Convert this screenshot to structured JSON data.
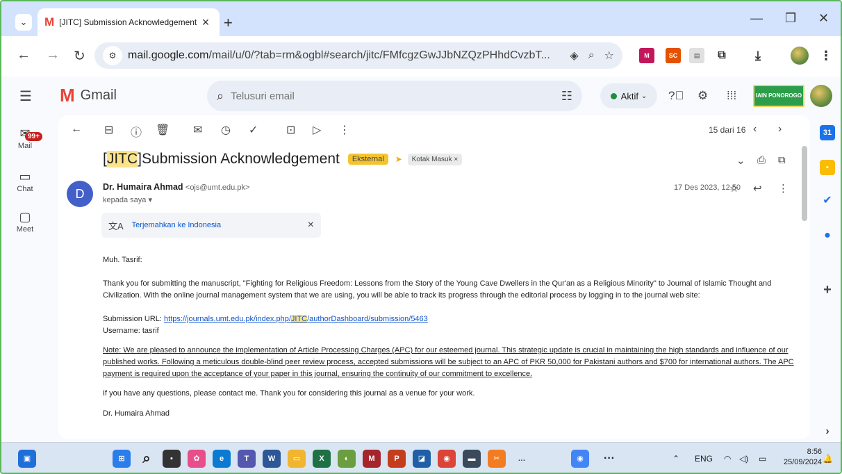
{
  "browser": {
    "tab_title": "[JITC] Submission Acknowledgement",
    "tab_favicon": "M",
    "url_host": "mail.google.com",
    "url_rest": "/mail/u/0/?tab=rm&ogbl#search/jitc/FMfcgzGwJJbNZQzPHhdCvzbT..."
  },
  "gmail": {
    "logo_text": "Gmail",
    "search_placeholder": "Telusuri email",
    "status": "Aktif",
    "org_logo": "IAIN PONOROGO",
    "rail": [
      {
        "label": "Mail",
        "badge": "99+"
      },
      {
        "label": "Chat"
      },
      {
        "label": "Meet"
      }
    ]
  },
  "email": {
    "pager": "15 dari 16",
    "subject_tag": "JITC",
    "subject_rest": " Submission Acknowledgement",
    "label_external": "Eksternal",
    "label_inbox": "Kotak Masuk",
    "sender_initial": "D",
    "sender_name": "Dr. Humaira Ahmad",
    "sender_email": "<ojs@umt.edu.pk>",
    "to": "kepada saya",
    "date": "17 Des 2023, 12.50",
    "translate_label": "Terjemahkan ke Indonesia",
    "greeting": "Muh. Tasrif:",
    "para1": "Thank you for submitting the manuscript, \"Fighting for Religious Freedom: Lessons from the Story of the Young Cave Dwellers in the Qur'an as a Religious Minority\" to Journal of Islamic Thought and Civilization. With the online journal management system that we are using, you will be able to track its progress through the editorial process by logging in to the journal web site:",
    "url_label": "Submission URL: ",
    "url_a": "https://journals.umt.edu.pk/index.php/",
    "url_tag": "JITC",
    "url_b": "/authorDashboard/submission/5463",
    "username": "Username: tasrif",
    "note": "Note: We are pleased to announce the implementation of Article Processing Charges (APC) for our esteemed journal. This strategic update is crucial in maintaining the high standards and influence of our published works. Following a meticulous double-blind peer review process, accepted submissions will be subject to an APC of PKR 50,000 for Pakistani authors and $700 for international authors. The APC payment is required upon the acceptance of your paper in this journal, ensuring the continuity of our commitment to excellence.",
    "closing": "If you have any questions, please contact me. Thank you for considering this journal as a venue for your work.",
    "signature": "Dr. Humaira Ahmad"
  },
  "taskbar": {
    "lang": "ENG",
    "time": "8:56",
    "date": "25/09/2024"
  },
  "colors": {
    "accent": "#0b57d0",
    "tab_strip": "#d3e3fd",
    "highlight": "#fbe38b",
    "external_chip": "#f4c430"
  }
}
